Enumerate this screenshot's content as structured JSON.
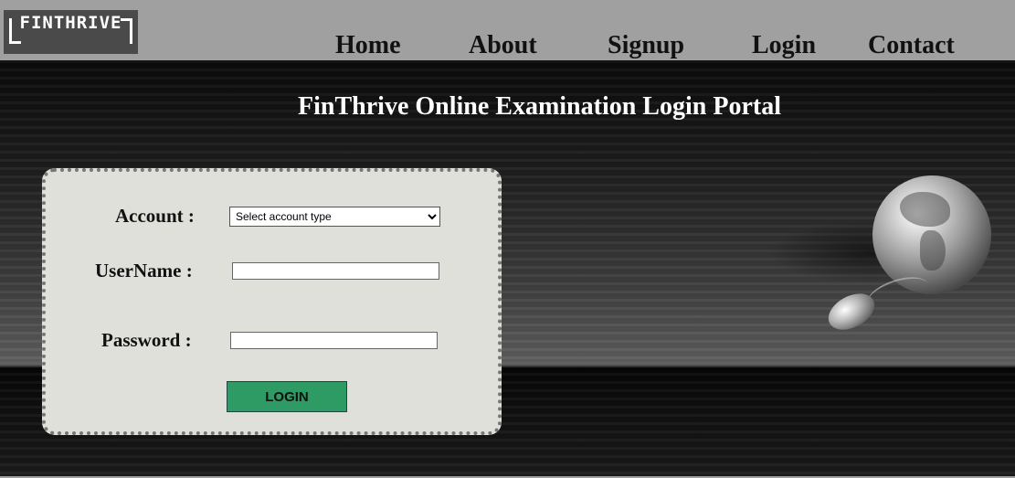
{
  "header": {
    "logo_text": "FINTHRIVE",
    "nav": [
      {
        "label": "Home"
      },
      {
        "label": "About"
      },
      {
        "label": "Signup"
      },
      {
        "label": "Login"
      },
      {
        "label": "Contact"
      }
    ]
  },
  "hero": {
    "title": "FinThrive Online Examination Login Portal"
  },
  "login_form": {
    "account_label": "Account :",
    "account_selected": "Select account type",
    "username_label": "UserName :",
    "username_value": "",
    "password_label": "Password :",
    "password_value": "",
    "submit_label": "LOGIN"
  },
  "colors": {
    "topbar": "#a0a0a0",
    "card_bg": "#e0e0db",
    "button": "#2e9a64"
  }
}
